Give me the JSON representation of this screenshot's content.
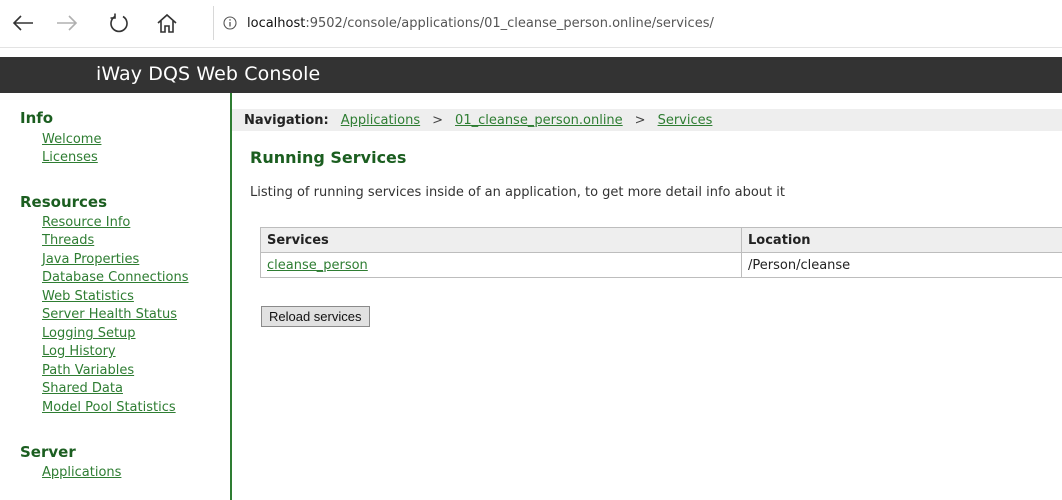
{
  "browser": {
    "url_host": "localhost",
    "url_rest": ":9502/console/applications/01_cleanse_person.online/services/"
  },
  "header": {
    "title": "iWay DQS Web Console"
  },
  "sidebar": {
    "sections": [
      {
        "title": "Info",
        "items": [
          "Welcome",
          "Licenses"
        ]
      },
      {
        "title": "Resources",
        "items": [
          "Resource Info",
          "Threads",
          "Java Properties",
          "Database Connections",
          "Web Statistics",
          "Server Health Status",
          "Logging Setup",
          "Log History",
          "Path Variables",
          "Shared Data",
          "Model Pool Statistics"
        ]
      },
      {
        "title": "Server",
        "items": [
          "Applications"
        ]
      }
    ]
  },
  "main": {
    "navigation_label": "Navigation:",
    "breadcrumbs": [
      "Applications",
      "01_cleanse_person.online",
      "Services"
    ],
    "separator": ">",
    "title": "Running Services",
    "description": "Listing of running services inside of an application, to get more detail info about it",
    "table": {
      "columns": [
        "Services",
        "Location"
      ],
      "rows": [
        {
          "service": "cleanse_person",
          "location": "/Person/cleanse"
        }
      ]
    },
    "reload_label": "Reload services"
  },
  "colors": {
    "link_green": "#2e7d32",
    "title_green": "#1b5e20",
    "header_bg": "#333333"
  }
}
